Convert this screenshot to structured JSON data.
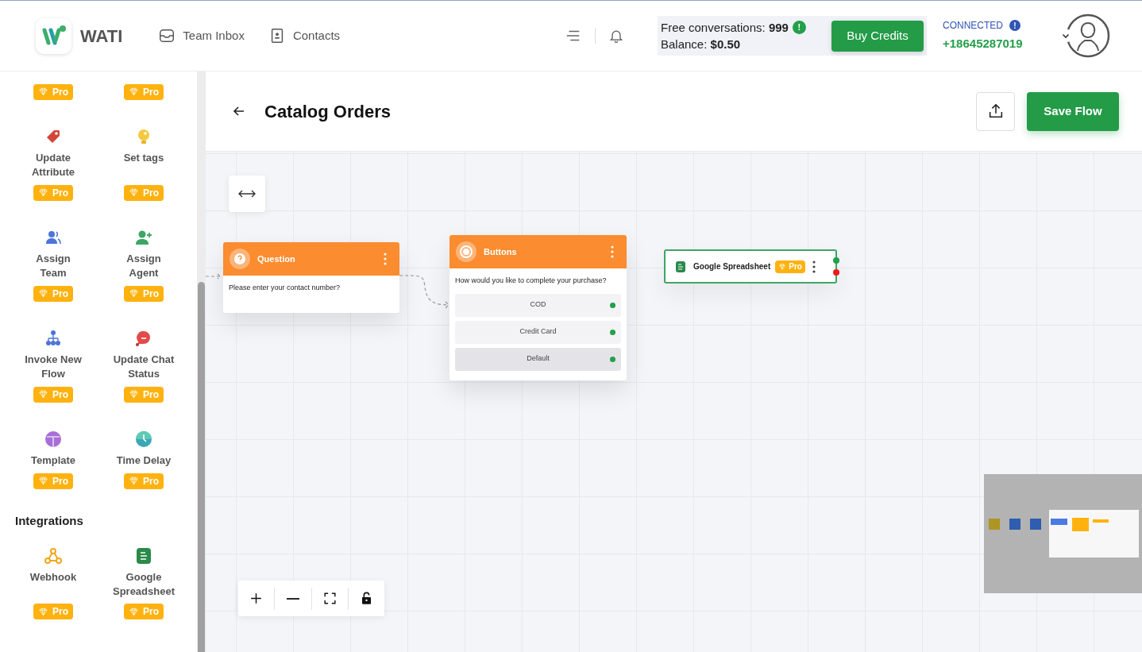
{
  "header": {
    "logo_text": "WATI",
    "nav": [
      {
        "label": "Team Inbox"
      },
      {
        "label": "Contacts"
      }
    ],
    "credits": {
      "free_label": "Free conversations:",
      "free_count": "999",
      "balance_label": "Balance:",
      "balance": "$0.50",
      "alert": "!"
    },
    "buy_button": "Buy Credits",
    "connection": {
      "status": "CONNECTED",
      "info": "!",
      "phone": "+18645287019"
    }
  },
  "sidebar": {
    "sections": [
      {
        "items": [
          {
            "badge": "Pro"
          },
          {
            "badge": "Pro"
          },
          {
            "label": "Update Attribute",
            "badge": "Pro"
          },
          {
            "label": "Set tags",
            "badge": "Pro"
          },
          {
            "label": "Assign Team",
            "badge": "Pro"
          },
          {
            "label": "Assign Agent",
            "badge": "Pro"
          },
          {
            "label": "Invoke New Flow",
            "badge": "Pro"
          },
          {
            "label": "Update Chat Status",
            "badge": "Pro"
          },
          {
            "label": "Template",
            "badge": "Pro"
          },
          {
            "label": "Time Delay",
            "badge": "Pro"
          }
        ]
      },
      {
        "heading": "Integrations",
        "items": [
          {
            "label": "Webhook",
            "badge": "Pro"
          },
          {
            "label": "Google Spreadsheet",
            "badge": "Pro"
          }
        ]
      }
    ]
  },
  "page": {
    "title": "Catalog Orders",
    "save_button": "Save Flow"
  },
  "canvas": {
    "nodes": [
      {
        "kind": "question",
        "title": "Question",
        "text": "Please enter your contact number?"
      },
      {
        "kind": "buttons",
        "title": "Buttons",
        "text": "How would you like to complete your purchase?",
        "options": [
          {
            "label": "COD",
            "kind": "option"
          },
          {
            "label": "Credit Card",
            "kind": "option"
          },
          {
            "label": "Default",
            "kind": "default"
          }
        ]
      },
      {
        "kind": "integration",
        "title": "Google Spreadsheet",
        "badge": "Pro"
      }
    ]
  }
}
